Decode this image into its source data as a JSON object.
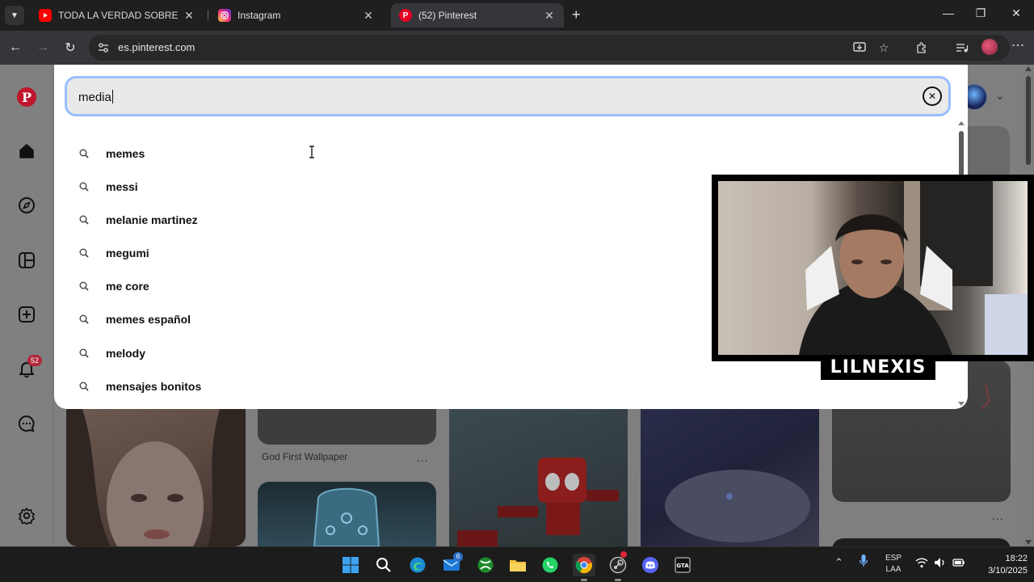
{
  "browser": {
    "tabs": [
      {
        "title": "TODA LA VERDAD SOBRE JEFFR",
        "favicon": "youtube-icon",
        "active": false
      },
      {
        "title": "Instagram",
        "favicon": "instagram-icon",
        "active": false
      },
      {
        "title": "(52) Pinterest",
        "favicon": "pinterest-icon",
        "active": true
      }
    ],
    "url": "es.pinterest.com"
  },
  "sidebar": {
    "items": [
      "home",
      "explore",
      "boards",
      "create",
      "notifications",
      "messages",
      "settings"
    ],
    "notification_count": "52"
  },
  "search": {
    "query": "media",
    "suggestions": [
      "memes",
      "messi",
      "melanie martinez",
      "megumi",
      "me core",
      "memes español",
      "melody",
      "mensajes bonitos"
    ]
  },
  "feed": {
    "pin_caption": "God First Wallpaper",
    "more_label": "..."
  },
  "overlay": {
    "streamer_name": "LILNEXIS"
  },
  "taskbar": {
    "apps": [
      "start",
      "search",
      "edge",
      "mail",
      "xbox",
      "file-explorer",
      "whatsapp",
      "chrome",
      "steam",
      "discord",
      "gta"
    ],
    "mail_badge": "6",
    "lang_top": "ESP",
    "lang_bottom": "LAA",
    "time": "18:22",
    "date": "3/10/2025"
  },
  "colors": {
    "pinterest_red": "#e60023",
    "search_focus_ring": "#99c0ff",
    "chrome_dark": "#35363a",
    "taskbar": "#1c1c1c"
  }
}
